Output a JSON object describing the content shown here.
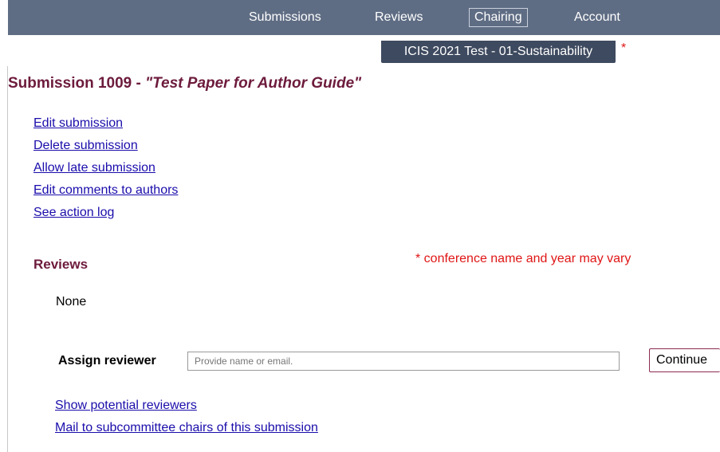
{
  "nav": {
    "items": [
      {
        "label": "Submissions"
      },
      {
        "label": "Reviews"
      },
      {
        "label": "Chairing",
        "active": true
      },
      {
        "label": "Account"
      }
    ],
    "conference": "ICIS 2021 Test - 01-Sustainability",
    "conference_marker": "*"
  },
  "submission": {
    "title_prefix": "Submission 1009 - ",
    "paper_title": "\"Test Paper for Author Guide\""
  },
  "actions": [
    {
      "label": "Edit submission"
    },
    {
      "label": "Delete submission"
    },
    {
      "label": "Allow late submission"
    },
    {
      "label": "Edit comments to authors"
    },
    {
      "label": "See action log"
    }
  ],
  "reviews": {
    "heading": "Reviews",
    "empty_text": "None",
    "note": "* conference name and year may vary"
  },
  "assign": {
    "label": "Assign reviewer",
    "placeholder": "Provide name or email.",
    "button_label": "Continue"
  },
  "links": [
    {
      "label": "Show potential reviewers"
    },
    {
      "label": "Mail to subcommittee chairs of this submission"
    }
  ],
  "colors": {
    "nav_bg": "#5f6d84",
    "conf_tab_bg": "#3e4a5f",
    "heading": "#6d1b3c",
    "link": "#1a0dab",
    "note_red": "#e01515"
  }
}
